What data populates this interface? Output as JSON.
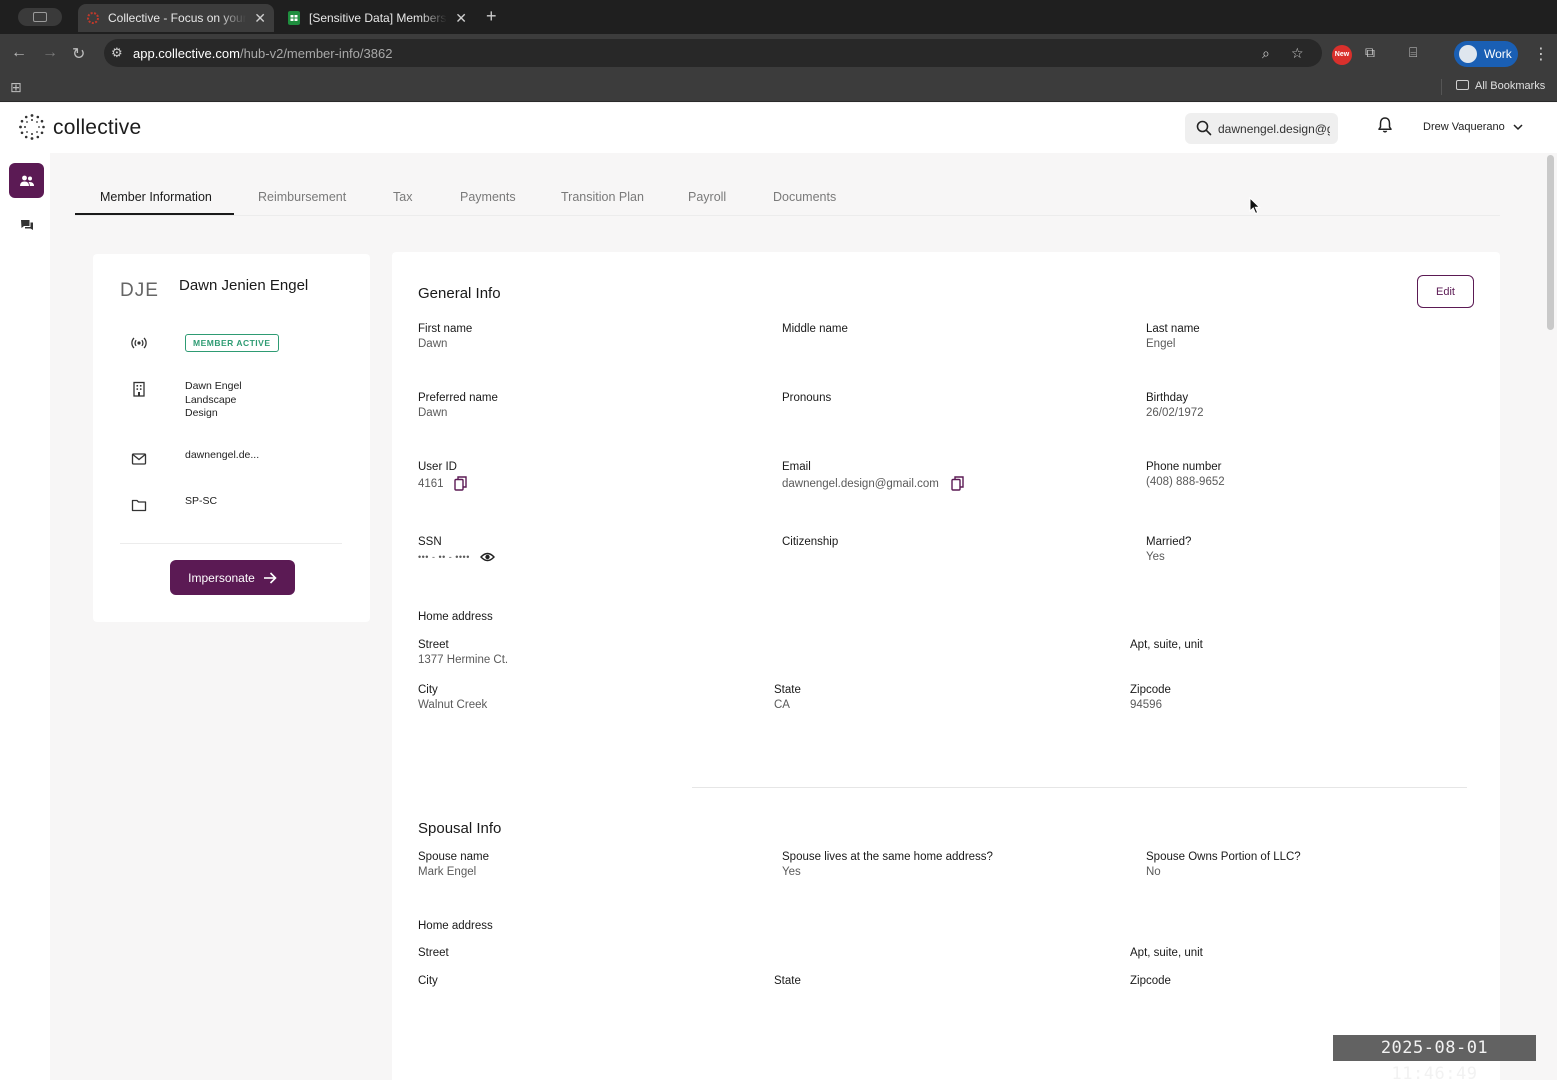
{
  "browser": {
    "tabs": [
      {
        "title": "Collective - Focus on your pa",
        "close": "✕"
      },
      {
        "title": "[Sensitive Data] Members wi",
        "close": "✕"
      }
    ],
    "new_tab": "+",
    "url_host": "app.collective.com",
    "url_path": "/hub-v2/member-info/3862",
    "new_badge": "New",
    "profile": "Work",
    "all_bookmarks": "All Bookmarks"
  },
  "header": {
    "logo": "collective",
    "search_value": "dawnengel.design@g",
    "user_name": "Drew Vaquerano"
  },
  "tabs": [
    {
      "label": "Member Information",
      "active": true
    },
    {
      "label": "Reimbursement"
    },
    {
      "label": "Tax"
    },
    {
      "label": "Payments"
    },
    {
      "label": "Transition Plan"
    },
    {
      "label": "Payroll"
    },
    {
      "label": "Documents"
    }
  ],
  "member": {
    "initials": "DJE",
    "name": "Dawn Jenien Engel",
    "status": "MEMBER ACTIVE",
    "company_lines": [
      "Dawn Engel",
      "Landscape",
      "Design"
    ],
    "email_short": "dawnengel.de...",
    "plan": "SP-SC",
    "impersonate_label": "Impersonate"
  },
  "general": {
    "title": "General Info",
    "edit_label": "Edit",
    "first_name": {
      "label": "First name",
      "value": "Dawn"
    },
    "middle_name": {
      "label": "Middle name",
      "value": ""
    },
    "last_name": {
      "label": "Last name",
      "value": "Engel"
    },
    "preferred_name": {
      "label": "Preferred name",
      "value": "Dawn"
    },
    "pronouns": {
      "label": "Pronouns",
      "value": ""
    },
    "birthday": {
      "label": "Birthday",
      "value": "26/02/1972"
    },
    "user_id": {
      "label": "User ID",
      "value": "4161"
    },
    "email": {
      "label": "Email",
      "value": "dawnengel.design@gmail.com"
    },
    "phone": {
      "label": "Phone number",
      "value": "(408) 888-9652"
    },
    "ssn": {
      "label": "SSN",
      "value": "••• - •• - ••••"
    },
    "citizenship": {
      "label": "Citizenship",
      "value": ""
    },
    "married": {
      "label": "Married?",
      "value": "Yes"
    },
    "home_address": {
      "title": "Home address",
      "street": {
        "label": "Street",
        "value": "1377 Hermine Ct."
      },
      "apt": {
        "label": "Apt, suite, unit",
        "value": ""
      },
      "city": {
        "label": "City",
        "value": "Walnut Creek"
      },
      "state": {
        "label": "State",
        "value": "CA"
      },
      "zip": {
        "label": "Zipcode",
        "value": "94596"
      }
    }
  },
  "spousal": {
    "title": "Spousal Info",
    "spouse_name": {
      "label": "Spouse name",
      "value": "Mark Engel"
    },
    "same_address": {
      "label": "Spouse lives at the same home address?",
      "value": "Yes"
    },
    "owns_llc": {
      "label": "Spouse Owns Portion of LLC?",
      "value": "No"
    },
    "home_address": {
      "title": "Home address",
      "street": {
        "label": "Street",
        "value": ""
      },
      "apt": {
        "label": "Apt, suite, unit",
        "value": ""
      },
      "city": {
        "label": "City",
        "value": ""
      },
      "state": {
        "label": "State",
        "value": ""
      },
      "zip": {
        "label": "Zipcode",
        "value": ""
      }
    }
  },
  "timestamp": "2025-08-01  11:46:49",
  "colors": {
    "brand": "#5b1a54",
    "active_green": "#2e9b73"
  }
}
